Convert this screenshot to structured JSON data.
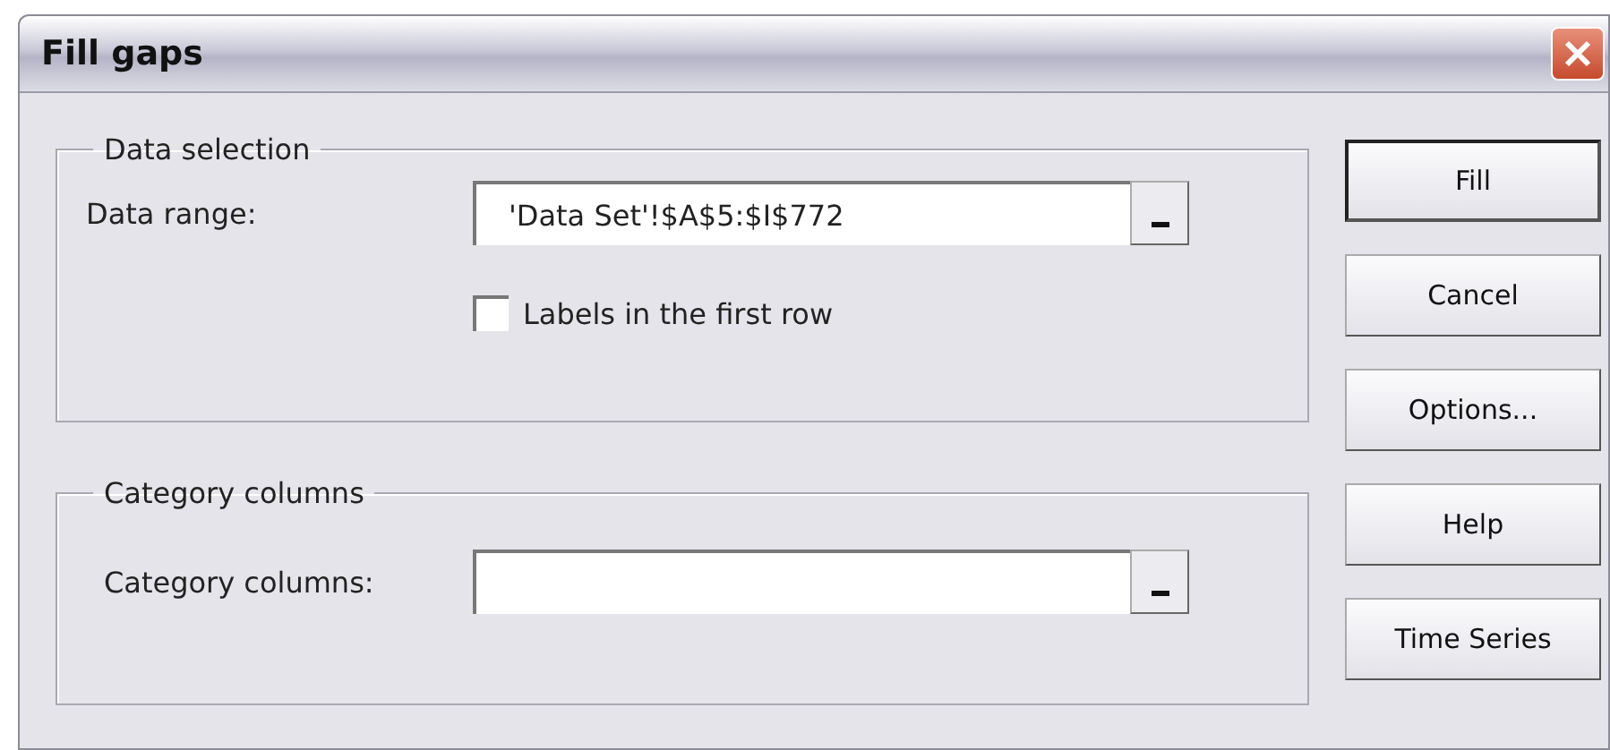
{
  "window": {
    "title": "Fill gaps"
  },
  "groups": [
    {
      "title": "Data selection",
      "field": {
        "label": "Data range:",
        "value": "'Data Set'!$A$5:$I$772"
      },
      "checkbox": {
        "label": "Labels in the first row",
        "checked": false
      }
    },
    {
      "title": "Category columns",
      "field": {
        "label": "Category columns:"
      }
    }
  ],
  "buttons": [
    {
      "label": "Fill",
      "default": true
    },
    {
      "label": "Cancel",
      "default": false
    },
    {
      "label": "Options...",
      "default": false
    },
    {
      "label": "Help",
      "default": false
    },
    {
      "label": "Time Series",
      "default": false
    }
  ]
}
